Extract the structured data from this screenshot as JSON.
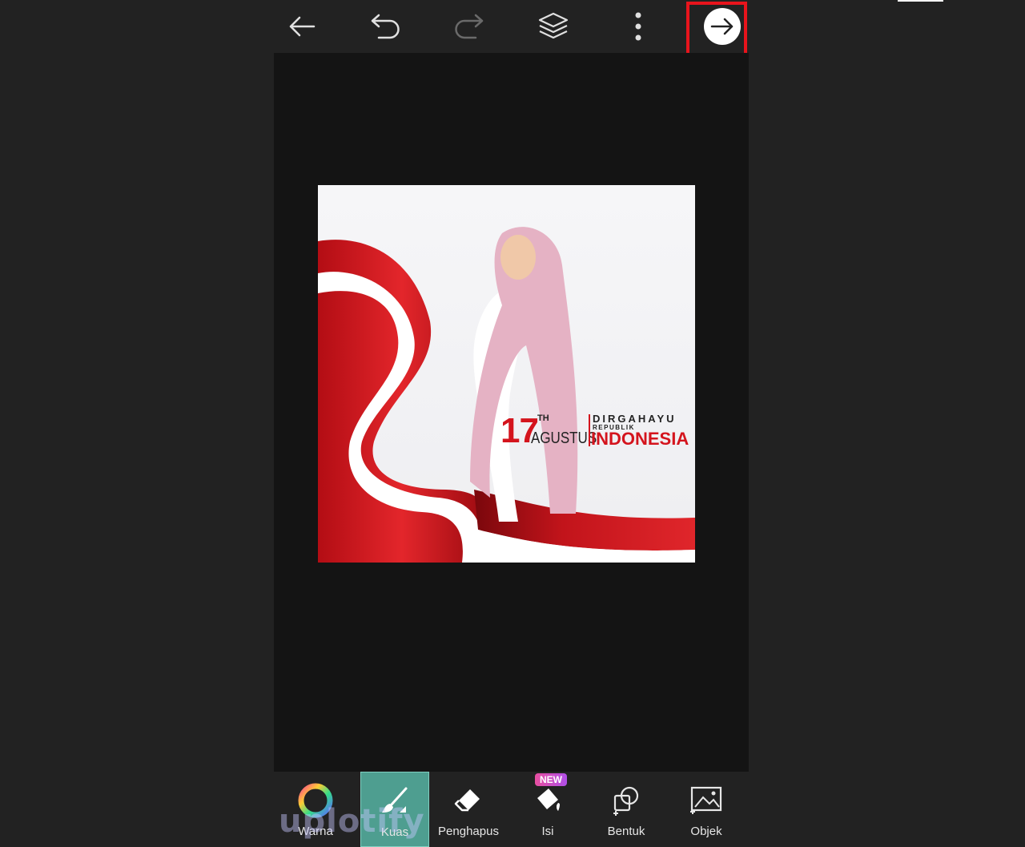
{
  "toolbar": {
    "back_icon": "arrow-left-icon",
    "undo_icon": "undo-icon",
    "redo_icon": "redo-icon",
    "layers_icon": "layers-icon",
    "more_icon": "more-vertical-icon",
    "next_icon": "arrow-right-circle-icon",
    "highlight_color": "#e8141c"
  },
  "artwork": {
    "num": "17",
    "th": "TH",
    "month": "AGUSTUS",
    "line1": "DIRGAHAYU",
    "line2": "REPUBLIK",
    "line3": "INDONESIA",
    "accent": "#d4141d"
  },
  "tools": [
    {
      "label": "Warna",
      "icon": "color-wheel-icon"
    },
    {
      "label": "Kuas",
      "icon": "brush-icon",
      "active": true
    },
    {
      "label": "Penghapus",
      "icon": "eraser-icon"
    },
    {
      "label": "Isi",
      "icon": "fill-bucket-icon",
      "badge": "NEW"
    },
    {
      "label": "Bentuk",
      "icon": "shape-icon"
    },
    {
      "label": "Objek",
      "icon": "image-object-icon"
    }
  ],
  "watermark": "uplotify",
  "active_color": "#4e9e90"
}
